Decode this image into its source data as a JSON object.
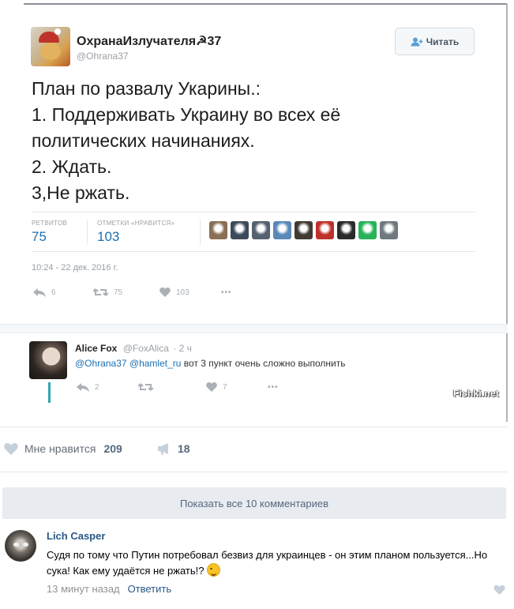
{
  "tweet": {
    "author_name": "ОхранаИзлучателя☭37",
    "author_handle": "@Ohrana37",
    "follow_label": "Читать",
    "text_lines": [
      "План по развалу Укарины.:",
      "1. Поддерживать Украину во всех её",
      "политических начинаниях.",
      "2. Ждать.",
      "3,Не ржать."
    ],
    "stats": {
      "retweets_label": "РЕТВИТОВ",
      "retweets_value": "75",
      "likes_label": "ОТМЕТКИ «НРАВИТСЯ»",
      "likes_value": "103"
    },
    "likers_colors": [
      "#8a6f55",
      "#3c4a5a",
      "#556070",
      "#5a88b8",
      "#403a32",
      "#c0302a",
      "#2a2a2a",
      "#27b35a",
      "#6f7a80"
    ],
    "timestamp": "10:24 - 22 дек. 2016 г.",
    "actions": {
      "reply_count": "6",
      "retweet_count": "75",
      "like_count": "103",
      "more": "•••"
    }
  },
  "reply": {
    "name": "Alice Fox",
    "handle": "@FoxAlica",
    "time": "· 2 ч",
    "mention1": "@Ohrana37",
    "mention2": "@hamlet_ru",
    "text": " вот 3 пункт очень сложно выполнить",
    "actions": {
      "reply_count": "2",
      "like_count": "7",
      "more": "•••"
    }
  },
  "watermark": "Fishki.net",
  "vk": {
    "like_label": "Мне нравится",
    "like_count": "209",
    "share_count": "18",
    "show_comments": "Показать все 10 комментариев",
    "comment": {
      "author": "Lich Casper",
      "text": "Судя по тому что Путин потребовал безвиз для украинцев - он этим планом пользуется...Но сука! Как ему удаётся не ржать!?",
      "time": "13 минут назад",
      "reply_label": "Ответить"
    }
  }
}
